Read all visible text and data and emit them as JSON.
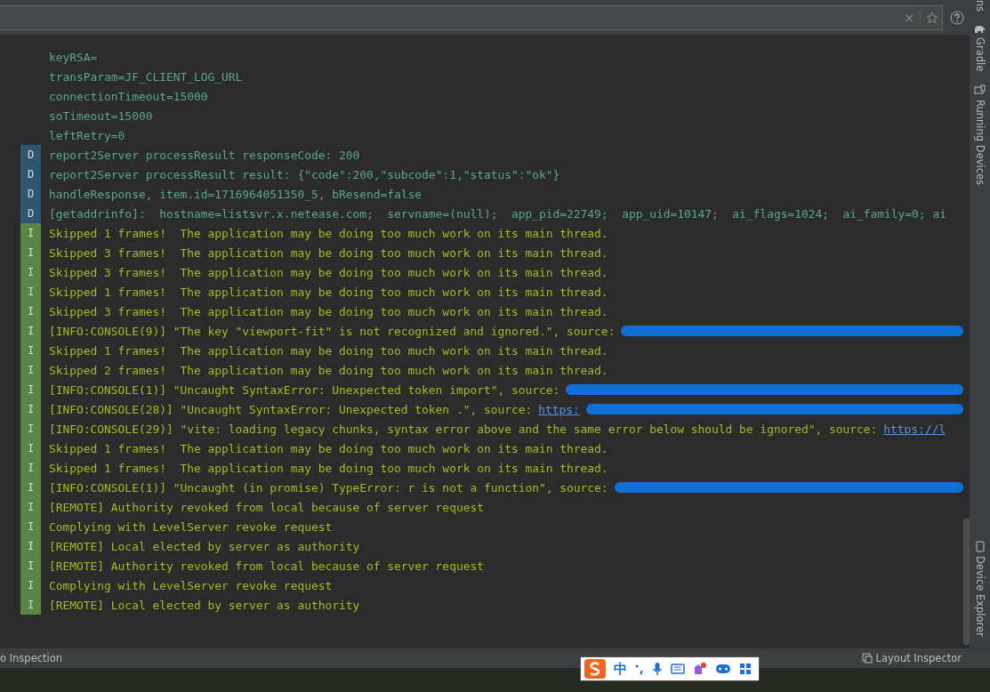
{
  "search": {
    "clear": "×"
  },
  "log": [
    {
      "kind": "plain",
      "text": "keyRSA="
    },
    {
      "kind": "plain",
      "text": "transParam=JF_CLIENT_LOG_URL"
    },
    {
      "kind": "plain",
      "text": "connectionTimeout=15000"
    },
    {
      "kind": "plain",
      "text": "soTimeout=15000"
    },
    {
      "kind": "plain",
      "text": "leftRetry=0"
    },
    {
      "kind": "debug",
      "badge": "D",
      "text": "report2Server processResult responseCode: 200"
    },
    {
      "kind": "debug",
      "badge": "D",
      "text": "report2Server processResult result: {\"code\":200,\"subcode\":1,\"status\":\"ok\"}"
    },
    {
      "kind": "debug",
      "badge": "D",
      "text": "handleResponse, item.id=1716964051350_5, bResend=false"
    },
    {
      "kind": "debug",
      "badge": "D",
      "text": "[getaddrinfo]:  hostname=listsvr.x.netease.com;  servname=(null);  app_pid=22749;  app_uid=10147;  ai_flags=1024;  ai_family=0; ai"
    },
    {
      "kind": "info",
      "badge": "I",
      "text": "Skipped 1 frames!  The application may be doing too much work on its main thread."
    },
    {
      "kind": "info",
      "badge": "I",
      "text": "Skipped 3 frames!  The application may be doing too much work on its main thread."
    },
    {
      "kind": "info",
      "badge": "I",
      "text": "Skipped 3 frames!  The application may be doing too much work on its main thread."
    },
    {
      "kind": "info",
      "badge": "I",
      "text": "Skipped 1 frames!  The application may be doing too much work on its main thread."
    },
    {
      "kind": "info",
      "badge": "I",
      "text": "Skipped 3 frames!  The application may be doing too much work on its main thread."
    },
    {
      "kind": "info",
      "badge": "I",
      "text": "[INFO:CONSOLE(9)] \"The key \"viewport-fit\" is not recognized and ignored.\", source:",
      "redacted": true
    },
    {
      "kind": "info",
      "badge": "I",
      "text": "Skipped 1 frames!  The application may be doing too much work on its main thread."
    },
    {
      "kind": "info",
      "badge": "I",
      "text": "Skipped 2 frames!  The application may be doing too much work on its main thread."
    },
    {
      "kind": "info",
      "badge": "I",
      "text": "[INFO:CONSOLE(1)] \"Uncaught SyntaxError: Unexpected token import\", source:",
      "redacted": true
    },
    {
      "kind": "info",
      "badge": "I",
      "text": "[INFO:CONSOLE(28)] \"Uncaught SyntaxError: Unexpected token .\", source:",
      "link": "https:",
      "redacted": true
    },
    {
      "kind": "info",
      "badge": "I",
      "text": "[INFO:CONSOLE(29)] \"vite: loading legacy chunks, syntax error above and the same error below should be ignored\", source:",
      "link": "https://l"
    },
    {
      "kind": "info",
      "badge": "I",
      "text": "Skipped 1 frames!  The application may be doing too much work on its main thread."
    },
    {
      "kind": "info",
      "badge": "I",
      "text": "Skipped 1 frames!  The application may be doing too much work on its main thread."
    },
    {
      "kind": "info",
      "badge": "I",
      "text": "[INFO:CONSOLE(1)] \"Uncaught (in promise) TypeError: r is not a function\", source:",
      "redacted": true
    },
    {
      "kind": "info",
      "badge": "I",
      "text": "[REMOTE] Authority revoked from local because of server request"
    },
    {
      "kind": "info",
      "badge": "I",
      "text": "Complying with LevelServer revoke request"
    },
    {
      "kind": "info",
      "badge": "I",
      "text": "[REMOTE] Local elected by server as authority"
    },
    {
      "kind": "info",
      "badge": "I",
      "text": "[REMOTE] Authority revoked from local because of server request"
    },
    {
      "kind": "info",
      "badge": "I",
      "text": "Complying with LevelServer revoke request"
    },
    {
      "kind": "info",
      "badge": "I",
      "text": "[REMOTE] Local elected by server as authority"
    }
  ],
  "side_tabs": [
    {
      "label": "ns"
    },
    {
      "label": "Gradle"
    },
    {
      "label": "Running Devices"
    },
    {
      "label": "Device Explorer"
    }
  ],
  "status_bar": {
    "left": "o Inspection",
    "right": "Layout Inspector"
  },
  "ime_bar": {
    "mode": "中"
  }
}
